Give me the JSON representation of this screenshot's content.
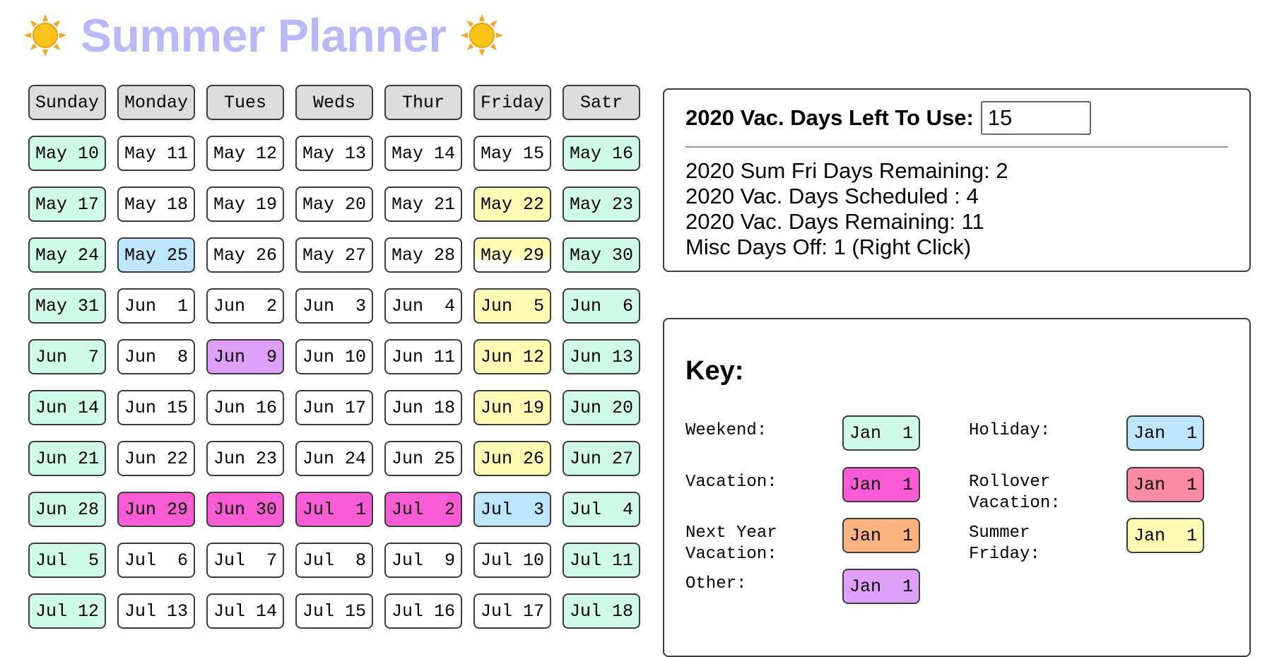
{
  "header": {
    "title": "Summer Planner",
    "left_icon": "sun-icon",
    "right_icon": "sun-icon"
  },
  "calendar": {
    "day_headers": [
      "Sunday",
      "Monday",
      "Tues",
      "Weds",
      "Thur",
      "Friday",
      "Satr"
    ],
    "weeks": [
      [
        {
          "label": "May 10",
          "type": "weekend"
        },
        {
          "label": "May 11",
          "type": "normal"
        },
        {
          "label": "May 12",
          "type": "normal"
        },
        {
          "label": "May 13",
          "type": "normal"
        },
        {
          "label": "May 14",
          "type": "normal"
        },
        {
          "label": "May 15",
          "type": "normal"
        },
        {
          "label": "May 16",
          "type": "weekend"
        }
      ],
      [
        {
          "label": "May 17",
          "type": "weekend"
        },
        {
          "label": "May 18",
          "type": "normal"
        },
        {
          "label": "May 19",
          "type": "normal"
        },
        {
          "label": "May 20",
          "type": "normal"
        },
        {
          "label": "May 21",
          "type": "normal"
        },
        {
          "label": "May 22",
          "type": "summer-friday"
        },
        {
          "label": "May 23",
          "type": "weekend"
        }
      ],
      [
        {
          "label": "May 24",
          "type": "weekend"
        },
        {
          "label": "May 25",
          "type": "holiday"
        },
        {
          "label": "May 26",
          "type": "normal"
        },
        {
          "label": "May 27",
          "type": "normal"
        },
        {
          "label": "May 28",
          "type": "normal"
        },
        {
          "label": "May 29",
          "type": "summer-friday-half"
        },
        {
          "label": "May 30",
          "type": "weekend"
        }
      ],
      [
        {
          "label": "May 31",
          "type": "weekend"
        },
        {
          "label": "Jun  1",
          "type": "normal"
        },
        {
          "label": "Jun  2",
          "type": "normal"
        },
        {
          "label": "Jun  3",
          "type": "normal"
        },
        {
          "label": "Jun  4",
          "type": "normal"
        },
        {
          "label": "Jun  5",
          "type": "summer-friday"
        },
        {
          "label": "Jun  6",
          "type": "weekend"
        }
      ],
      [
        {
          "label": "Jun  7",
          "type": "weekend"
        },
        {
          "label": "Jun  8",
          "type": "normal"
        },
        {
          "label": "Jun  9",
          "type": "other"
        },
        {
          "label": "Jun 10",
          "type": "normal"
        },
        {
          "label": "Jun 11",
          "type": "normal"
        },
        {
          "label": "Jun 12",
          "type": "summer-friday"
        },
        {
          "label": "Jun 13",
          "type": "weekend"
        }
      ],
      [
        {
          "label": "Jun 14",
          "type": "weekend"
        },
        {
          "label": "Jun 15",
          "type": "normal"
        },
        {
          "label": "Jun 16",
          "type": "normal"
        },
        {
          "label": "Jun 17",
          "type": "normal"
        },
        {
          "label": "Jun 18",
          "type": "normal"
        },
        {
          "label": "Jun 19",
          "type": "summer-friday"
        },
        {
          "label": "Jun 20",
          "type": "weekend"
        }
      ],
      [
        {
          "label": "Jun 21",
          "type": "weekend"
        },
        {
          "label": "Jun 22",
          "type": "normal"
        },
        {
          "label": "Jun 23",
          "type": "normal"
        },
        {
          "label": "Jun 24",
          "type": "normal"
        },
        {
          "label": "Jun 25",
          "type": "normal"
        },
        {
          "label": "Jun 26",
          "type": "summer-friday"
        },
        {
          "label": "Jun 27",
          "type": "weekend"
        }
      ],
      [
        {
          "label": "Jun 28",
          "type": "weekend"
        },
        {
          "label": "Jun 29",
          "type": "vacation"
        },
        {
          "label": "Jun 30",
          "type": "vacation"
        },
        {
          "label": "Jul  1",
          "type": "vacation"
        },
        {
          "label": "Jul  2",
          "type": "vacation"
        },
        {
          "label": "Jul  3",
          "type": "holiday"
        },
        {
          "label": "Jul  4",
          "type": "weekend"
        }
      ],
      [
        {
          "label": "Jul  5",
          "type": "weekend"
        },
        {
          "label": "Jul  6",
          "type": "normal"
        },
        {
          "label": "Jul  7",
          "type": "normal"
        },
        {
          "label": "Jul  8",
          "type": "normal"
        },
        {
          "label": "Jul  9",
          "type": "normal"
        },
        {
          "label": "Jul 10",
          "type": "normal"
        },
        {
          "label": "Jul 11",
          "type": "weekend"
        }
      ],
      [
        {
          "label": "Jul 12",
          "type": "weekend"
        },
        {
          "label": "Jul 13",
          "type": "normal"
        },
        {
          "label": "Jul 14",
          "type": "normal"
        },
        {
          "label": "Jul 15",
          "type": "normal"
        },
        {
          "label": "Jul 16",
          "type": "normal"
        },
        {
          "label": "Jul 17",
          "type": "normal"
        },
        {
          "label": "Jul 18",
          "type": "weekend"
        }
      ]
    ]
  },
  "stats": {
    "vac_days_label": "2020 Vac. Days Left To Use:",
    "vac_days_value": "15",
    "lines": [
      "2020 Sum Fri Days Remaining: 2",
      "2020 Vac. Days Scheduled : 4",
      "2020 Vac. Days Remaining: 11",
      "Misc Days Off: 1 (Right Click)"
    ]
  },
  "key": {
    "title": "Key:",
    "sample_date": "Jan  1",
    "items": {
      "weekend": "Weekend:",
      "holiday": "Holiday:",
      "vacation": "Vacation:",
      "rollover": "Rollover\nVacation:",
      "next_year": "Next Year\nVacation:",
      "summer_friday": "Summer\nFriday:",
      "other": "Other:"
    }
  },
  "colors": {
    "title": "#b9b9f7",
    "weekend": "#cffaea",
    "holiday": "#bde5fb",
    "vacation": "#f95bd5",
    "rollover": "#fb8aa6",
    "next_year": "#fcb27e",
    "summer_friday": "#fdfbb4",
    "other": "#dea0f9",
    "header_cell": "#dcdcdc"
  }
}
